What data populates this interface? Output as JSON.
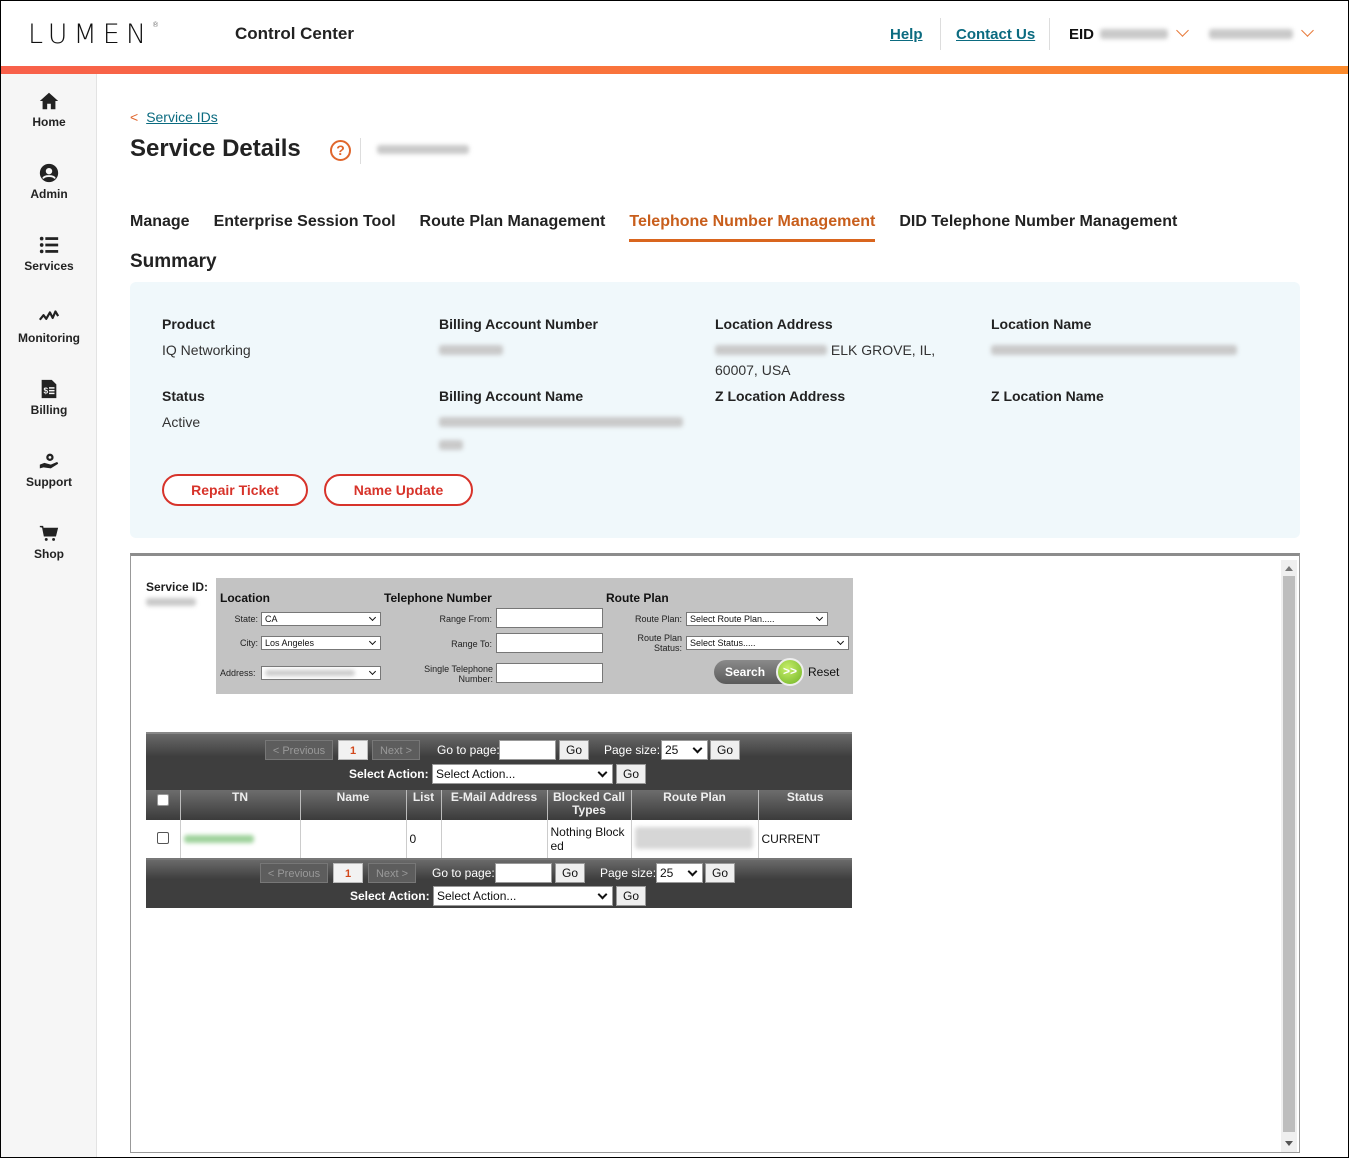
{
  "header": {
    "logo": "LUMEN",
    "app_title": "Control Center",
    "help_link": "Help",
    "contact_link": "Contact Us",
    "eid_label": "EID"
  },
  "sidebar": {
    "items": [
      {
        "label": "Home",
        "icon": "home-icon"
      },
      {
        "label": "Admin",
        "icon": "user-circle-icon"
      },
      {
        "label": "Services",
        "icon": "list-icon"
      },
      {
        "label": "Monitoring",
        "icon": "pulse-icon"
      },
      {
        "label": "Billing",
        "icon": "invoice-icon"
      },
      {
        "label": "Support",
        "icon": "support-gear-hand-icon"
      },
      {
        "label": "Shop",
        "icon": "cart-icon"
      }
    ]
  },
  "breadcrumb": {
    "back_label": "Service IDs"
  },
  "page": {
    "title": "Service Details",
    "help_icon": "?"
  },
  "tabs": [
    {
      "label": "Manage",
      "active": false
    },
    {
      "label": "Enterprise Session Tool",
      "active": false
    },
    {
      "label": "Route Plan Management",
      "active": false
    },
    {
      "label": "Telephone Number Management",
      "active": true
    },
    {
      "label": "DID Telephone Number Management",
      "active": false
    }
  ],
  "summary": {
    "title": "Summary",
    "fields": {
      "product": {
        "label": "Product",
        "value": "IQ Networking"
      },
      "status": {
        "label": "Status",
        "value": "Active"
      },
      "billing_account_number": {
        "label": "Billing Account Number"
      },
      "billing_account_name": {
        "label": "Billing Account Name"
      },
      "location_address": {
        "label": "Location Address",
        "value_visible": "ELK GROVE, IL,",
        "value_line2": "60007, USA"
      },
      "z_location_address": {
        "label": "Z Location Address"
      },
      "location_name": {
        "label": "Location Name"
      },
      "z_location_name": {
        "label": "Z Location Name"
      }
    },
    "buttons": {
      "repair_ticket": "Repair Ticket",
      "name_update": "Name Update"
    }
  },
  "tn_tool": {
    "service_id_label": "Service ID:",
    "filter": {
      "location_title": "Location",
      "state_label": "State:",
      "state_value": "CA",
      "city_label": "City:",
      "city_value": "Los Angeles",
      "address_label": "Address:",
      "tn_title": "Telephone Number",
      "range_from_label": "Range From:",
      "range_to_label": "Range To:",
      "single_tn_label_1": "Single Telephone",
      "single_tn_label_2": "Number:",
      "route_plan_title": "Route Plan",
      "route_plan_label": "Route Plan:",
      "route_plan_value": "Select Route Plan.....",
      "route_plan_status_label_1": "Route Plan",
      "route_plan_status_label_2": "Status:",
      "route_plan_status_value": "Select Status.....",
      "search_label": "Search",
      "go_icon": ">>",
      "reset_label": "Reset"
    },
    "pager": {
      "previous": "< Previous",
      "current_page": "1",
      "next": "Next >",
      "go_to_page_label": "Go to page:",
      "go_label": "Go",
      "page_size_label": "Page size:",
      "page_size_value": "25",
      "select_action_label": "Select Action:",
      "select_action_value": "Select Action..."
    },
    "columns": [
      "TN",
      "Name",
      "List",
      "E-Mail Address",
      "Blocked Call Types",
      "Route Plan",
      "Status"
    ],
    "rows": [
      {
        "tn": "",
        "name": "",
        "list": "0",
        "email": "",
        "blocked_call_types": "Nothing Blocked",
        "route_plan": "",
        "status": "CURRENT"
      }
    ]
  }
}
